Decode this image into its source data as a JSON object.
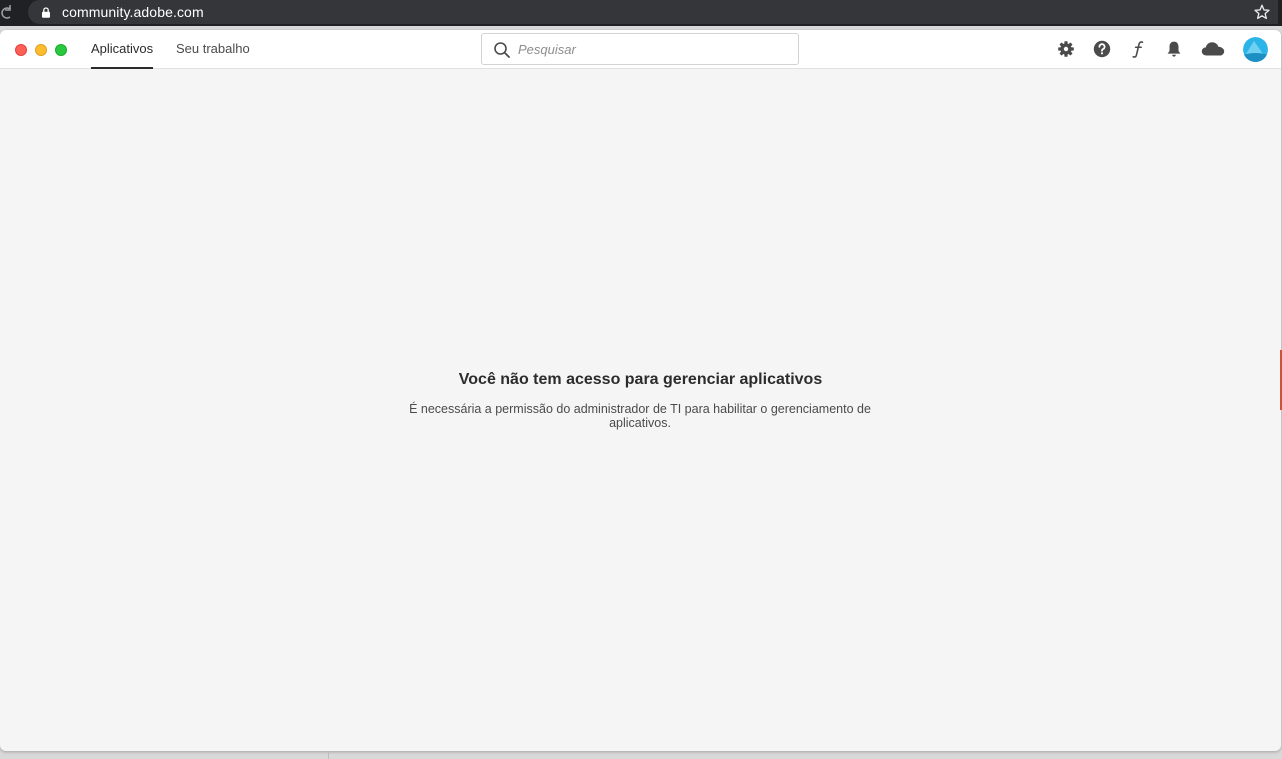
{
  "browser": {
    "url": "community.adobe.com"
  },
  "header": {
    "tabs": [
      {
        "label": "Aplicativos",
        "active": true
      },
      {
        "label": "Seu trabalho",
        "active": false
      }
    ],
    "search": {
      "placeholder": "Pesquisar",
      "value": ""
    },
    "icons": [
      "gear-icon",
      "help-icon",
      "fonts-icon",
      "bell-icon",
      "cloud-icon",
      "avatar"
    ]
  },
  "main": {
    "title": "Você não tem acesso para gerenciar aplicativos",
    "description": "É necessária a permissão do administrador de TI para habilitar o gerenciamento de aplicativos."
  },
  "colors": {
    "background": "#f5f5f5",
    "header": "#ffffff",
    "text_primary": "#2c2c2c",
    "text_secondary": "#4b4b4b",
    "traffic_close": "#fe5f57",
    "traffic_min": "#febc2e",
    "traffic_max": "#28c840",
    "avatar_accent": "#2ab4e8"
  }
}
